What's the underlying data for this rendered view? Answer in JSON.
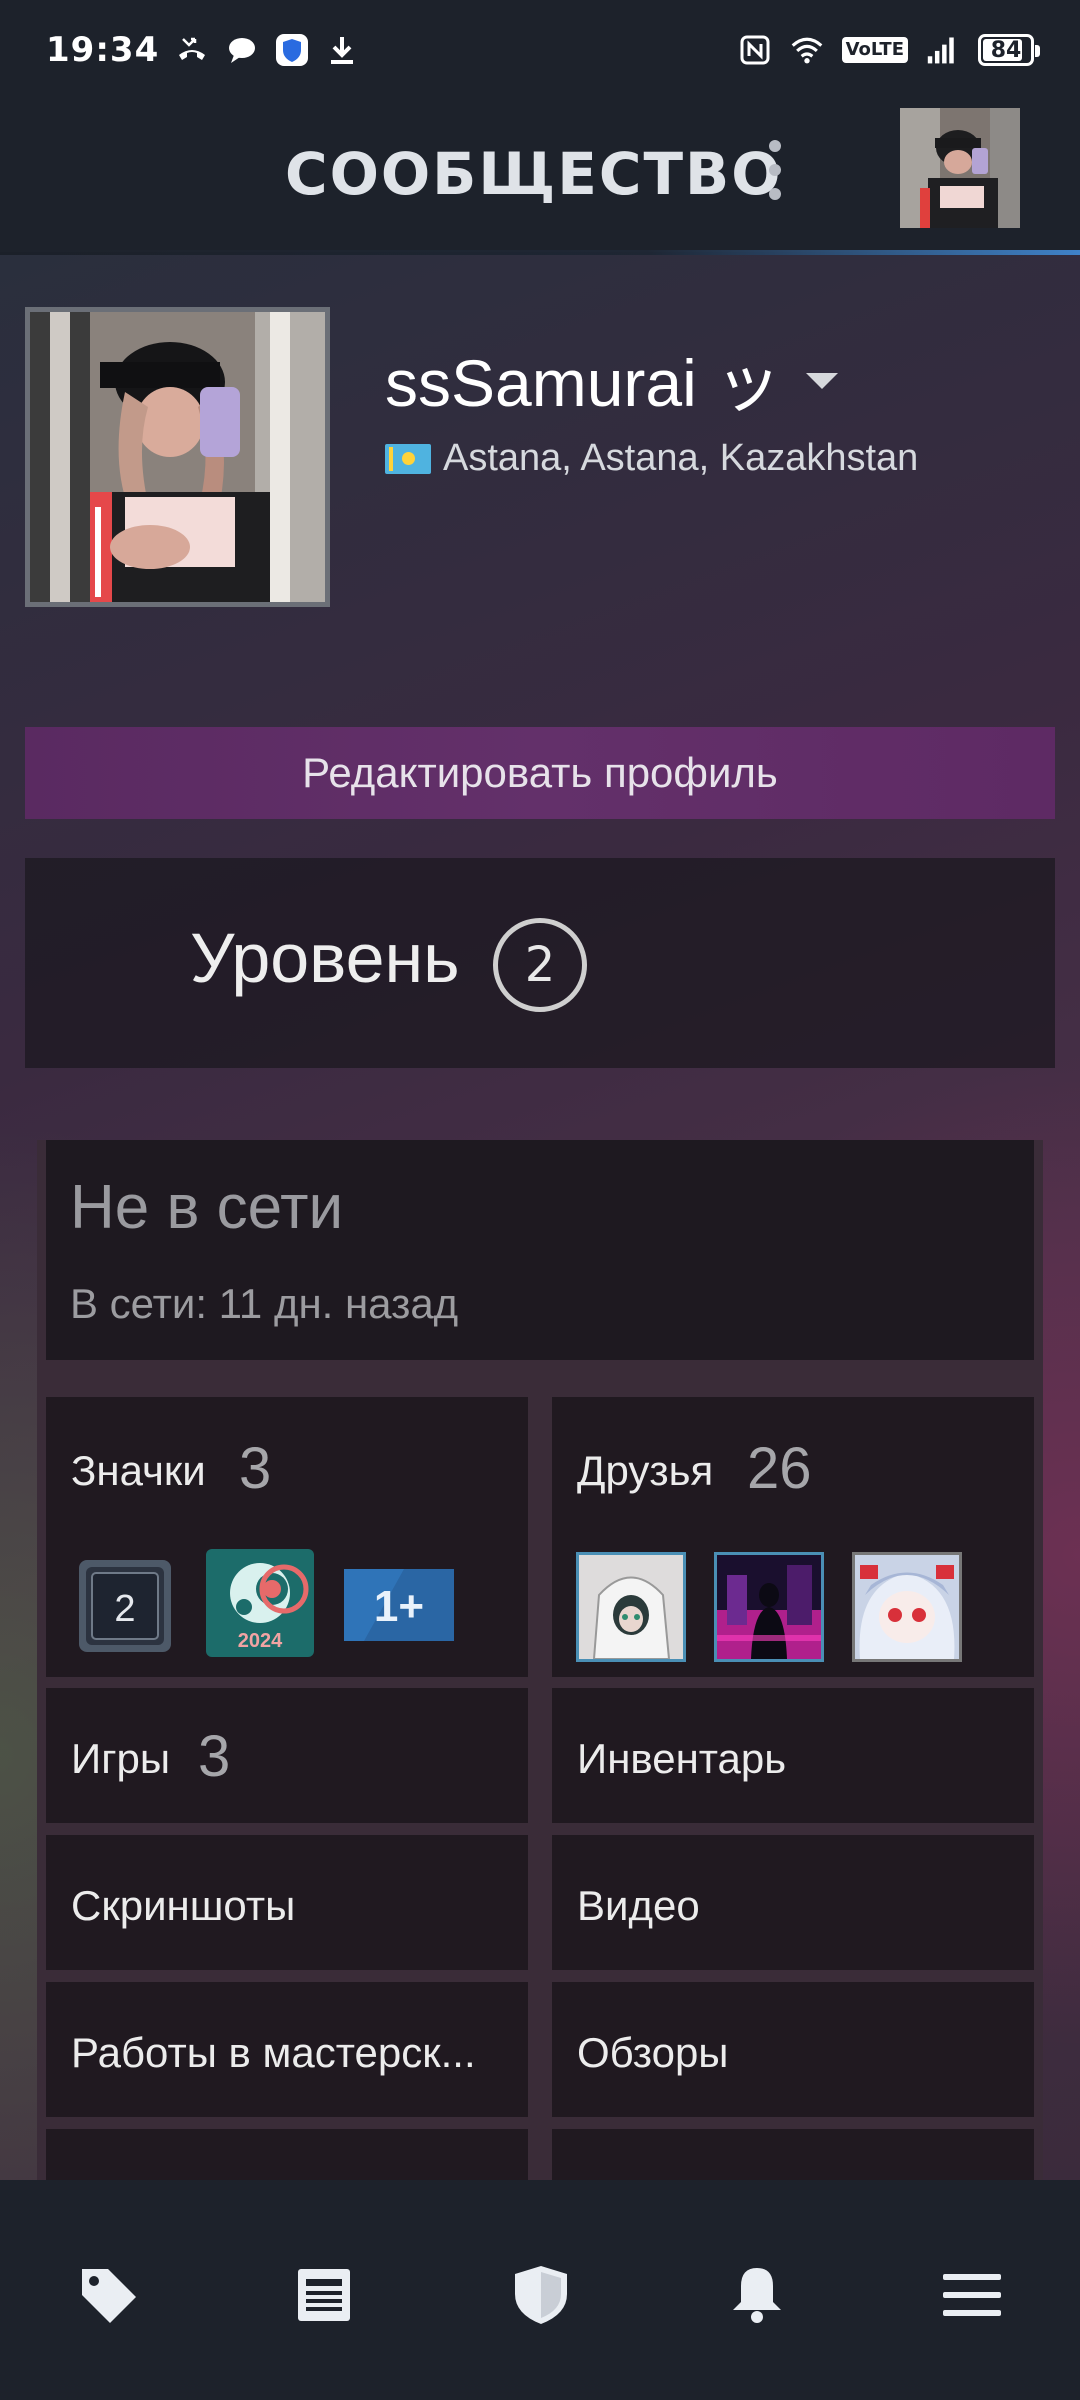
{
  "status_bar": {
    "time": "19:34",
    "network_badge": "VoLTE",
    "battery_percent": "84",
    "battery_level": 0.84
  },
  "header": {
    "title": "СООБЩЕСТВО"
  },
  "profile": {
    "persona_name": "ssSamurai ッ",
    "location": "Astana, Astana, Kazakhstan",
    "edit_profile_label": "Редактировать профиль",
    "level_label": "Уровень",
    "level_value": "2"
  },
  "status": {
    "state": "Не в сети",
    "last_online": "В сети: 11 дн. назад"
  },
  "tiles": {
    "badges": {
      "label": "Значки",
      "count": "3",
      "level_badge_text": "2",
      "year_badge_text": "2024",
      "years_badge_text": "1+"
    },
    "friends": {
      "label": "Друзья",
      "count": "26"
    },
    "games": {
      "label": "Игры",
      "count": "3"
    },
    "inventory": {
      "label": "Инвентарь"
    },
    "screenshots": {
      "label": "Скриншоты"
    },
    "videos": {
      "label": "Видео"
    },
    "workshop": {
      "label": "Работы в мастерск..."
    },
    "reviews": {
      "label": "Обзоры"
    }
  },
  "bottom_nav": {
    "items": [
      "store-tag-icon",
      "news-icon",
      "shield-icon",
      "bell-icon",
      "menu-icon"
    ]
  },
  "colors": {
    "accent_blue": "#3f82c8",
    "edit_button": "#5e2a64",
    "app_background": "#1d222b"
  }
}
